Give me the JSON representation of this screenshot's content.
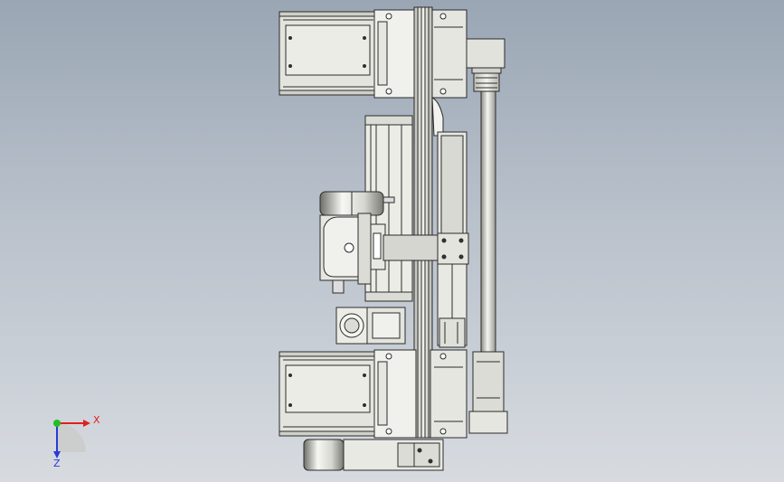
{
  "axes": {
    "x_label": "X",
    "z_label": "Z",
    "x_color": "#e02020",
    "z_color": "#2a3ad8",
    "y_color": "#20c020"
  },
  "colors": {
    "background_top": "#9aa6b4",
    "background_bottom": "#d7dbe0",
    "body_fill": "#e9e9e4",
    "shade": "#cfcfc8",
    "outline": "#2b2b2b"
  }
}
